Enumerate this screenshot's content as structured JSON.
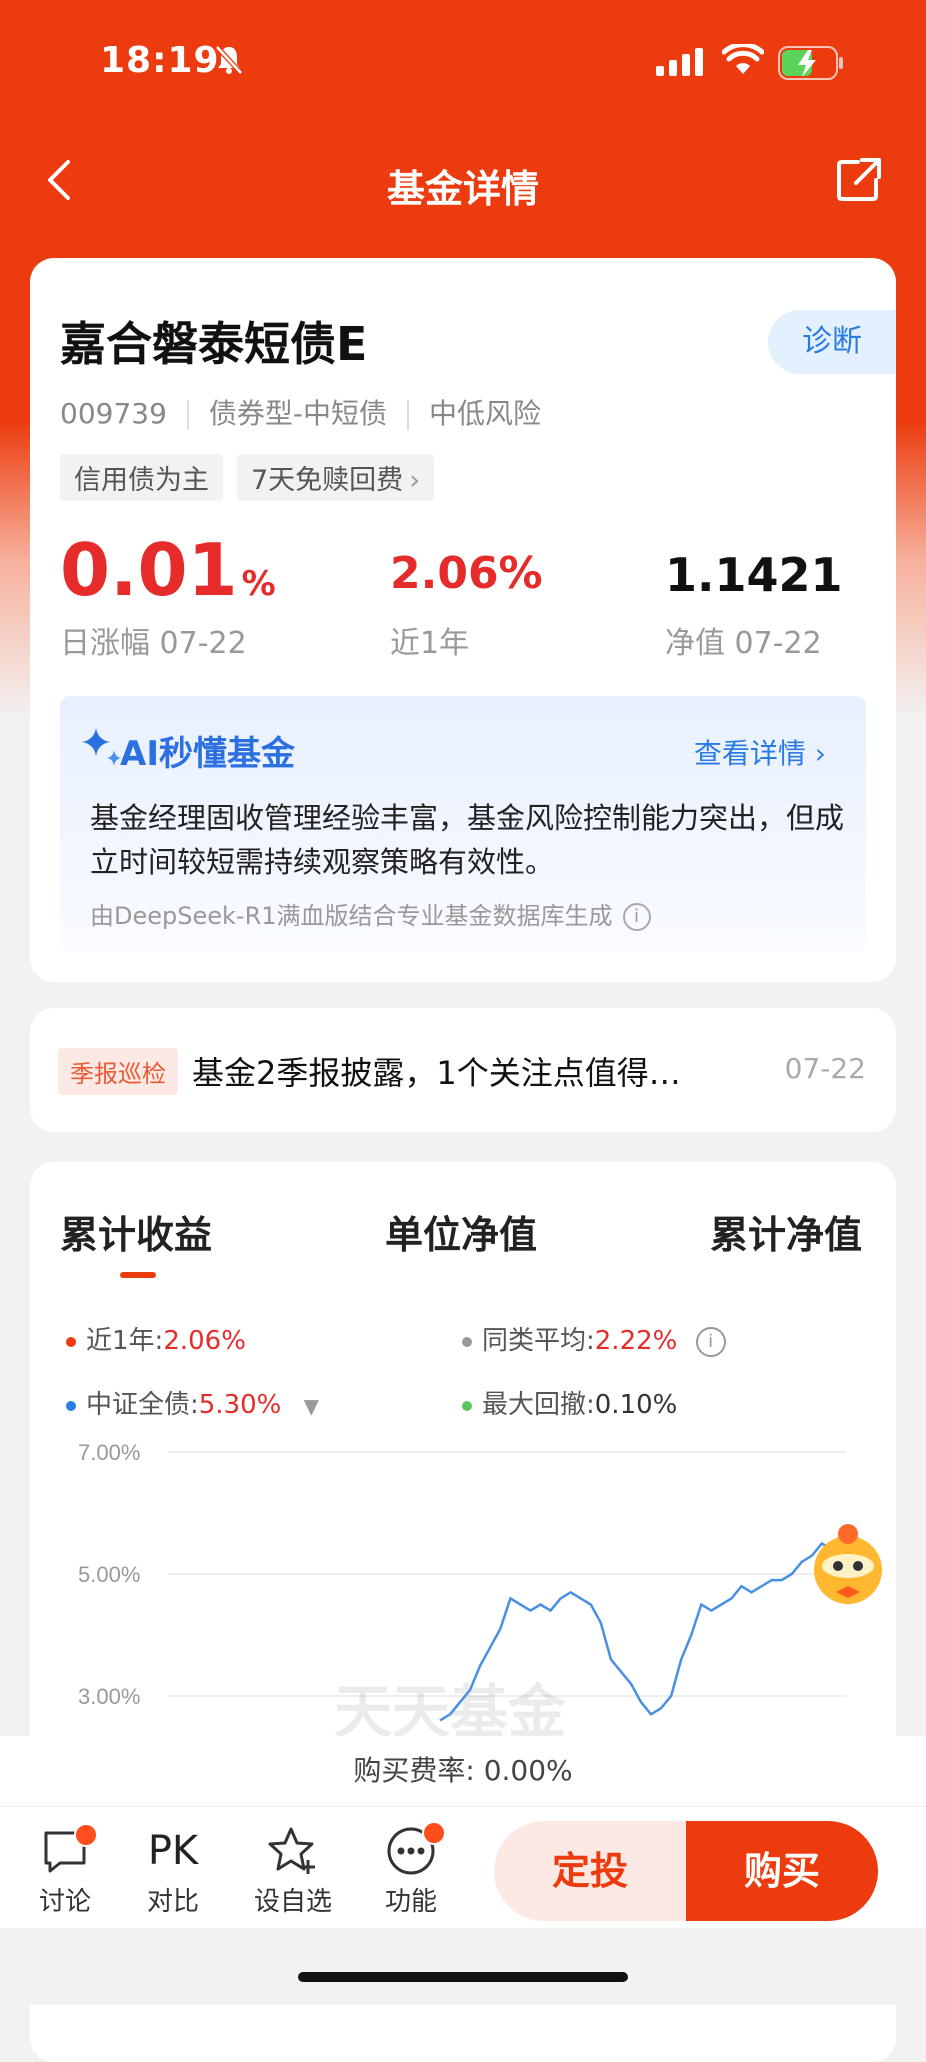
{
  "status": {
    "time": "18:19"
  },
  "nav": {
    "title": "基金详情"
  },
  "fund": {
    "name": "嘉合磐泰短债E",
    "diagnose_label": "诊断",
    "code": "009739",
    "category": "债券型-中短债",
    "risk": "中低风险",
    "tags": [
      "信用债为主",
      "7天免赎回费"
    ],
    "daily_change": "0.01",
    "daily_change_unit": "%",
    "daily_change_label": "日涨幅 07-22",
    "year_return": "2.06%",
    "year_return_label": "近1年",
    "nav_value": "1.1421",
    "nav_label": "净值 07-22"
  },
  "ai": {
    "title": "AI秒懂基金",
    "link": "查看详情",
    "text": "基金经理固收管理经验丰富，基金风险控制能力突出，但成立时间较短需持续观察策略有效性。",
    "footer": "由DeepSeek-R1满血版结合专业基金数据库生成"
  },
  "report": {
    "tag": "季报巡检",
    "text": "基金2季报披露，1个关注点值得…",
    "date": "07-22"
  },
  "chart_tabs": [
    "累计收益",
    "单位净值",
    "累计净值"
  ],
  "legend": {
    "l1_label": "近1年:",
    "l1_value": "2.06%",
    "l2_label": "同类平均:",
    "l2_value": "2.22%",
    "l3_label": "中证全债:",
    "l3_value": "5.30%",
    "l4_label": "最大回撤:",
    "l4_value": "0.10%"
  },
  "colors": {
    "accent": "#ec3b0e",
    "up": "#e62b2b",
    "line": "#4a90e2",
    "blue_link": "#2b7be4"
  },
  "chart_data": {
    "type": "line",
    "ylim": [
      2.6,
      7.0
    ],
    "y_ticks": [
      "7.00%",
      "5.00%",
      "3.00%"
    ],
    "series": [
      {
        "name": "中证全债",
        "values": [
          2.6,
          2.7,
          2.9,
          3.1,
          3.5,
          3.8,
          4.1,
          4.6,
          4.5,
          4.4,
          4.5,
          4.4,
          4.6,
          4.7,
          4.6,
          4.5,
          4.2,
          3.6,
          3.4,
          3.2,
          2.9,
          2.7,
          2.8,
          3.0,
          3.6,
          4.0,
          4.5,
          4.4,
          4.5,
          4.6,
          4.8,
          4.7,
          4.8,
          4.9,
          4.9,
          5.0,
          5.2,
          5.3,
          5.5,
          5.4,
          5.3
        ]
      }
    ]
  },
  "watermark": "天天基金",
  "fee": {
    "label": "购买费率:",
    "value": "0.00%"
  },
  "toolbar": {
    "discuss": "讨论",
    "pk": "PK",
    "compare": "对比",
    "watch": "设自选",
    "func": "功能",
    "regular": "定投",
    "buy": "购买"
  }
}
